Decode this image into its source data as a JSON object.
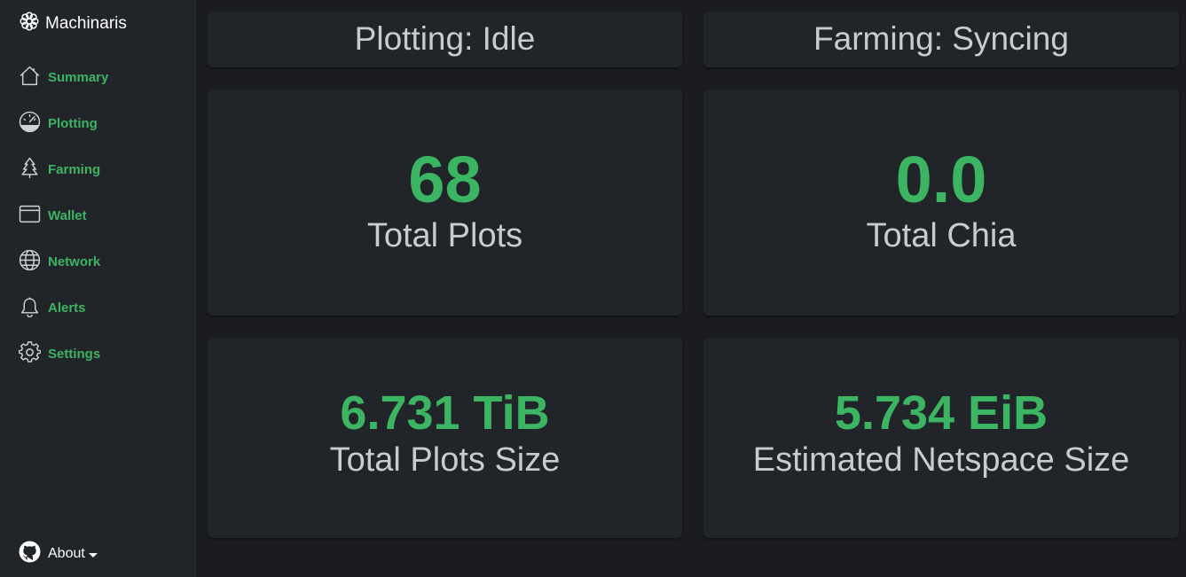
{
  "app": {
    "title": "Machinaris"
  },
  "sidebar": {
    "items": [
      {
        "label": "Summary",
        "icon": "house-icon"
      },
      {
        "label": "Plotting",
        "icon": "speedometer-icon"
      },
      {
        "label": "Farming",
        "icon": "tree-icon"
      },
      {
        "label": "Wallet",
        "icon": "wallet-icon"
      },
      {
        "label": "Network",
        "icon": "globe-icon"
      },
      {
        "label": "Alerts",
        "icon": "bell-icon"
      },
      {
        "label": "Settings",
        "icon": "gear-icon"
      }
    ],
    "about_label": "About"
  },
  "status": {
    "plotting": "Plotting: Idle",
    "farming": "Farming: Syncing"
  },
  "stats": {
    "total_plots": {
      "value": "68",
      "label": "Total Plots"
    },
    "total_chia": {
      "value": "0.0",
      "label": "Total Chia"
    },
    "plots_size": {
      "value": "6.731 TiB",
      "label": "Total Plots Size"
    },
    "netspace": {
      "value": "5.734 EiB",
      "label": "Estimated Netspace Size"
    }
  },
  "colors": {
    "accent": "#3cb563",
    "background": "#1a1c1f",
    "panel": "#212428",
    "text_muted": "#c8ccd0"
  }
}
